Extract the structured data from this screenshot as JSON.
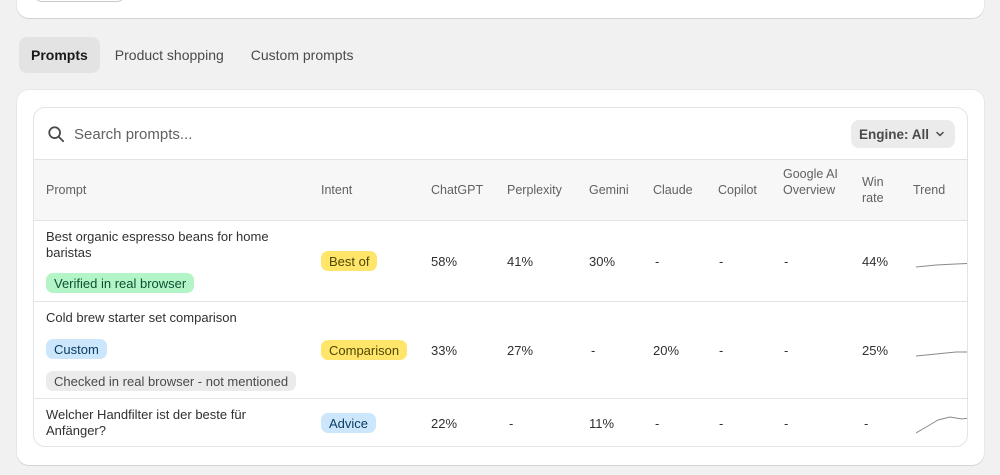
{
  "tabs": [
    {
      "label": "Prompts",
      "active": true
    },
    {
      "label": "Product shopping",
      "active": false
    },
    {
      "label": "Custom prompts",
      "active": false
    }
  ],
  "search": {
    "placeholder": "Search prompts..."
  },
  "engine_filter": {
    "label": "Engine: All"
  },
  "table": {
    "columns": {
      "prompt": "Prompt",
      "intent": "Intent",
      "chatgpt": "ChatGPT",
      "perplexity": "Perplexity",
      "gemini": "Gemini",
      "claude": "Claude",
      "copilot": "Copilot",
      "google_ai_overview": "Google AI Overview",
      "win_rate": "Win rate",
      "trend": "Trend"
    },
    "rows": [
      {
        "prompt": "Best organic espresso beans for home baristas",
        "tags": [
          "Verified in real browser"
        ],
        "intent": "Best of",
        "chatgpt": "58%",
        "perplexity": "41%",
        "gemini": "30%",
        "claude": "-",
        "copilot": "-",
        "google_ai_overview": "-",
        "win_rate": "44%"
      },
      {
        "prompt": "Cold brew starter set comparison",
        "tags": [
          "Custom",
          "Checked in real browser - not mentioned"
        ],
        "intent": "Comparison",
        "chatgpt": "33%",
        "perplexity": "27%",
        "gemini": "-",
        "claude": "20%",
        "copilot": "-",
        "google_ai_overview": "-",
        "win_rate": "25%"
      },
      {
        "prompt": "Welcher Handfilter ist der beste für Anfänger?",
        "tags": [],
        "intent": "Advice",
        "chatgpt": "22%",
        "perplexity": "-",
        "gemini": "11%",
        "claude": "-",
        "copilot": "-",
        "google_ai_overview": "-",
        "win_rate": "-"
      }
    ]
  },
  "colors": {
    "page_bg": "#f1f1f1",
    "card_bg": "#ffffff",
    "active_tab_bg": "#e3e3e3",
    "verified_badge": "#b4f5c8",
    "custom_badge": "#cce7fb",
    "intent_badge": "#ffe66b",
    "advice_badge": "#cce7fb"
  },
  "icons": {
    "search": "search-icon",
    "chevron": "chevron-down-icon"
  }
}
